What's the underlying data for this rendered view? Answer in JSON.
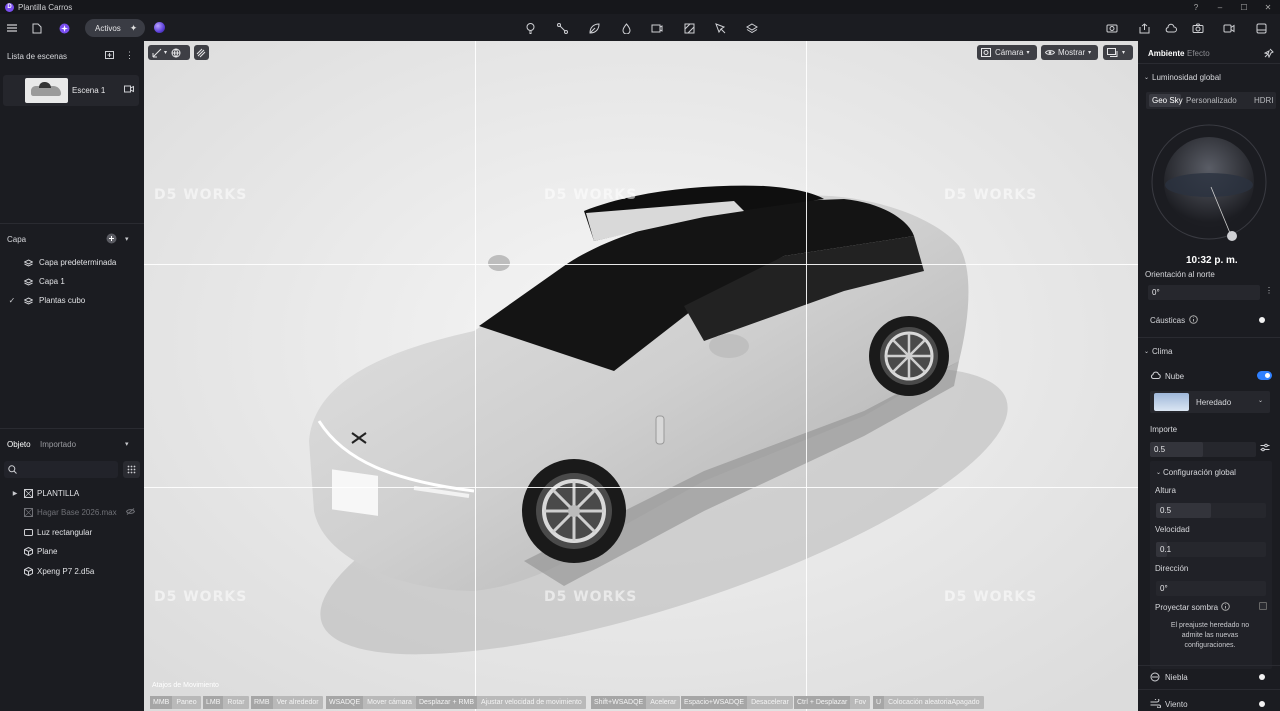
{
  "window": {
    "title": "Plantilla Carros",
    "logo_glyph": "D"
  },
  "toolbar": {
    "activos_label": "Activos"
  },
  "left": {
    "scenes_title": "Lista de escenas",
    "scene_name": "Escena 1",
    "layer_title": "Capa",
    "layers": [
      "Capa predeterminada",
      "Capa 1",
      "Plantas cubo"
    ],
    "object_tab": "Objeto",
    "imported_tab": "Importado",
    "objects": [
      "PLANTILLA",
      "Hagar Base 2026.max",
      "Luz rectangular",
      "Plane",
      "Xpeng P7 2.d5a"
    ]
  },
  "viewport": {
    "camera_label": "Cámara",
    "show_label": "Mostrar",
    "watermark": "D5 WORKS",
    "hints_title": "Atajos de Movimiento",
    "hints": [
      {
        "key": "MMB",
        "text": "Paneo"
      },
      {
        "key": "LMB",
        "text": "Rotar"
      },
      {
        "key": "RMB",
        "text": "Ver alrededor"
      },
      {
        "key": "WSADQE",
        "text": "Mover cámara"
      },
      {
        "key": "Desplazar + RMB",
        "text": "Ajustar velocidad de movimiento"
      },
      {
        "key": "Shift+WSADQE",
        "text": "Acelerar"
      },
      {
        "key": "Espacio+WSADQE",
        "text": "Desacelerar"
      },
      {
        "key": "Ctrl + Desplazar",
        "text": "Fov"
      },
      {
        "key": "U",
        "text": "Colocación aleatoriaApagado"
      }
    ]
  },
  "right": {
    "tab_ambiente": "Ambiente",
    "tab_efecto": "Efecto",
    "section_lum": "Luminosidad global",
    "sky_tabs": [
      "Geo Sky",
      "Personalizado",
      "HDRI"
    ],
    "time": "10:32 p. m.",
    "orient_label": "Orientación al norte",
    "orient_value": "0°",
    "causticas": "Cáusticas",
    "section_clima": "Clima",
    "nube": "Nube",
    "preset": "Heredado",
    "importe_label": "Importe",
    "importe_value": "0.5",
    "config_global": "Configuración global",
    "altura_label": "Altura",
    "altura_value": "0.5",
    "velocidad_label": "Velocidad",
    "velocidad_value": "0.1",
    "direccion_label": "Dirección",
    "direccion_value": "0°",
    "sombra_label": "Proyectar sombra",
    "notice": "El preajuste heredado no admite las nuevas configuraciones.",
    "niebla": "Niebla",
    "viento": "Viento",
    "accent_color": "#2f80ff"
  }
}
